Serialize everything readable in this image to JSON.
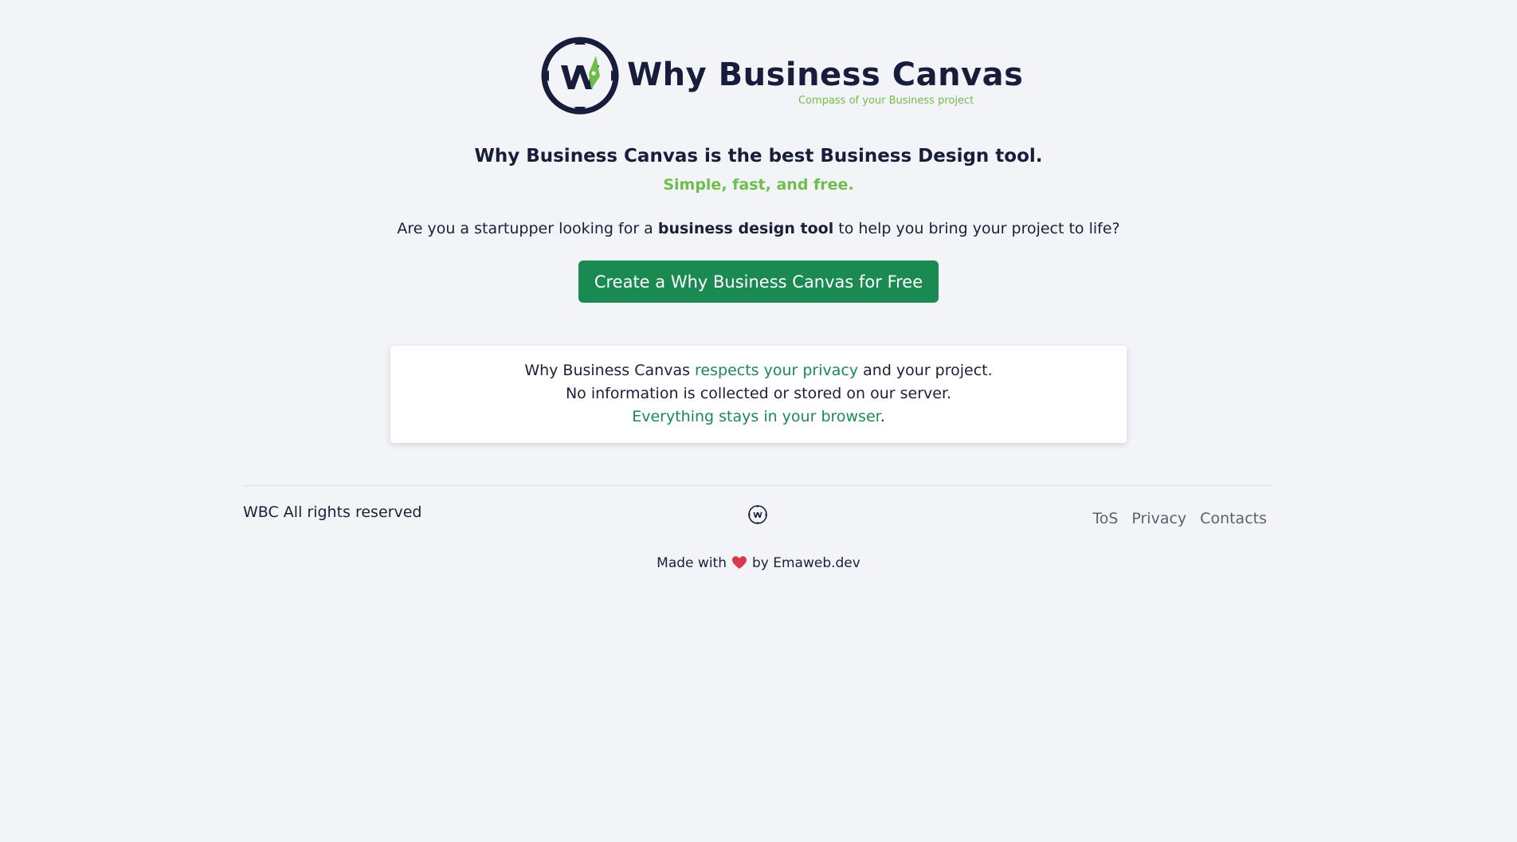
{
  "brand": {
    "name": "Why Business Canvas",
    "tagline": "Compass of your Business project",
    "accent_color": "#6fbe4c",
    "primary_color": "#1b8a52",
    "dark_color": "#171d3a"
  },
  "hero": {
    "headline": "Why Business Canvas is the best Business Design tool.",
    "subheadline": "Simple, fast, and free.",
    "lead_before": "Are you a startupper looking for a ",
    "lead_bold": "business design tool",
    "lead_after": " to help you bring your project to life?",
    "cta_label": "Create a Why Business Canvas for Free"
  },
  "privacy": {
    "line1_before": "Why Business Canvas ",
    "line1_link": "respects your privacy",
    "line1_after": " and your project.",
    "line2": "No information is collected or stored on our server.",
    "line3_link": "Everything stays in your browser",
    "line3_after": "."
  },
  "footer": {
    "copyright": "WBC All rights reserved",
    "links": [
      "ToS",
      "Privacy",
      "Contacts"
    ],
    "made_with_before": "Made with",
    "made_with_after": "by Emaweb.dev",
    "heart_icon": "heart-icon",
    "heart_color": "#d93a4a"
  }
}
